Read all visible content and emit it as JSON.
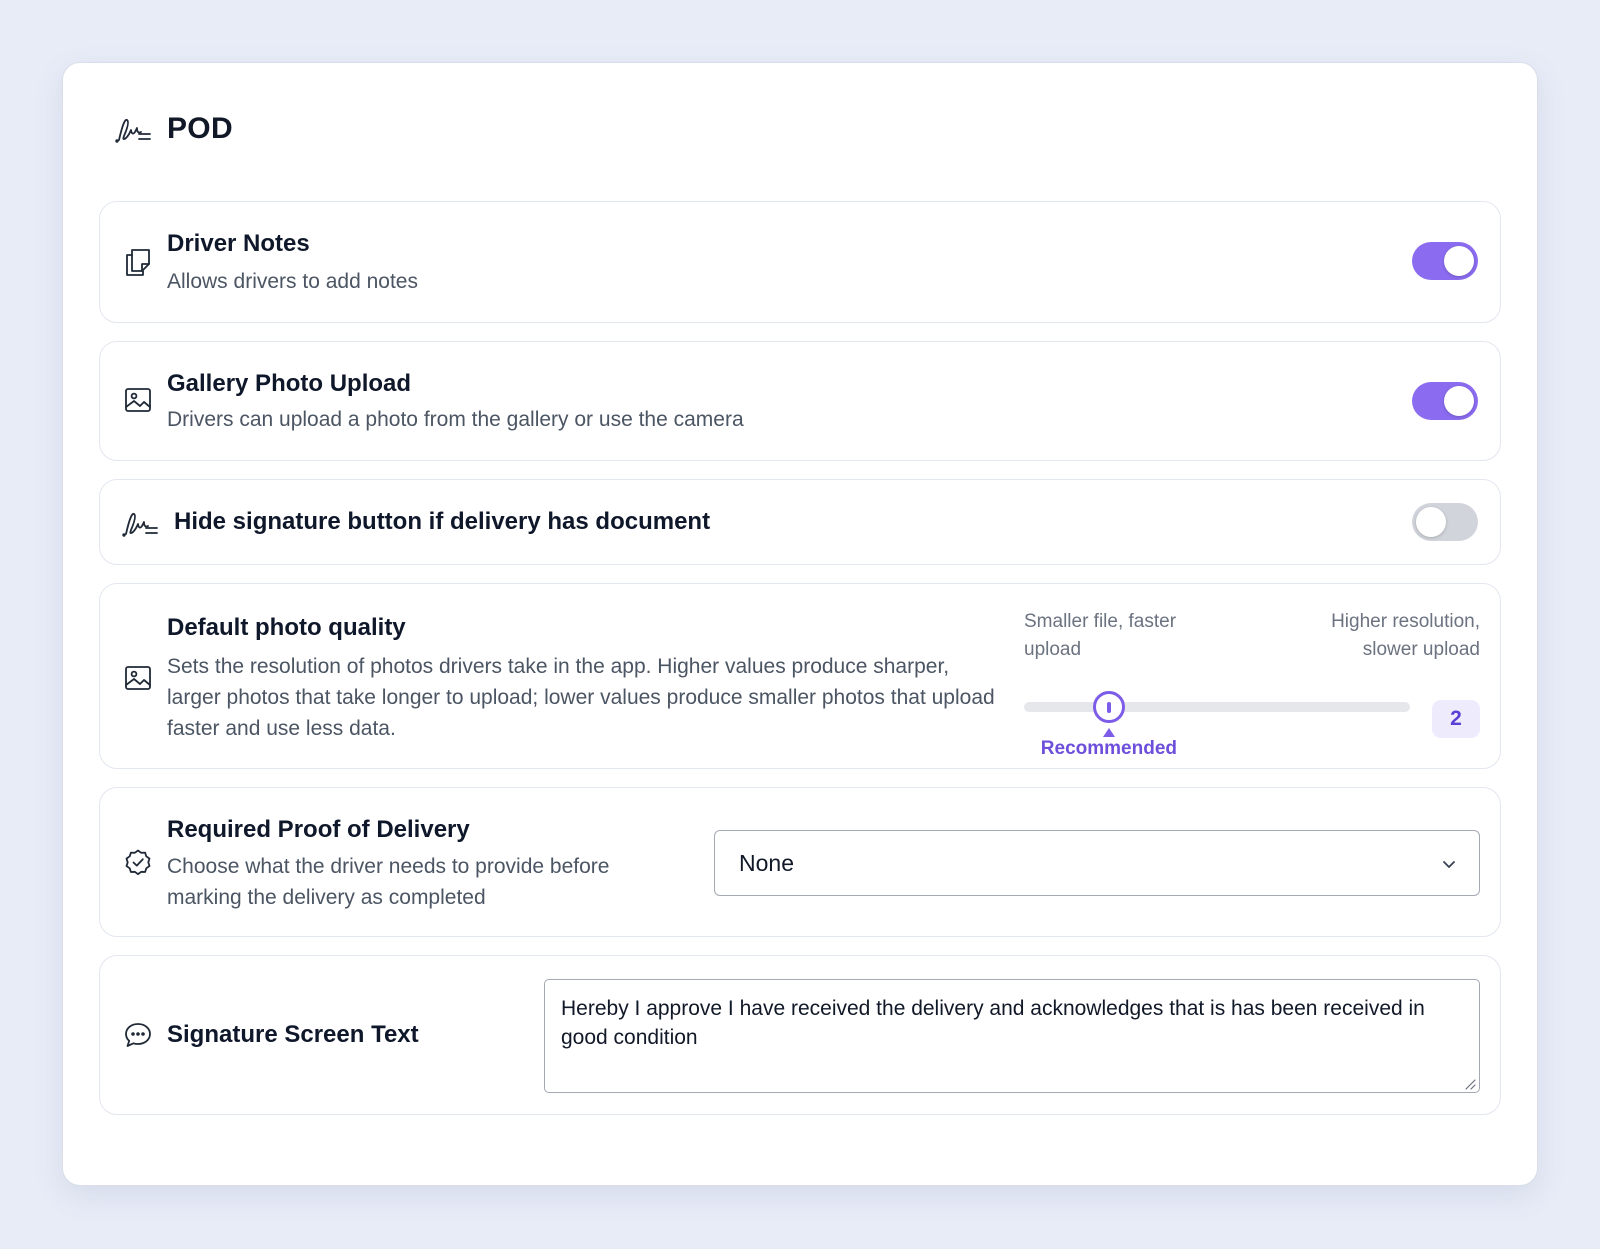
{
  "panel": {
    "title": "POD",
    "icon": "signature-icon"
  },
  "settings": {
    "driver_notes": {
      "title": "Driver Notes",
      "description": "Allows drivers to add notes",
      "icon": "notes-icon",
      "enabled": true
    },
    "gallery_upload": {
      "title": "Gallery Photo Upload",
      "description": "Drivers can upload a photo from the gallery or use the camera",
      "icon": "image-icon",
      "enabled": true
    },
    "hide_signature": {
      "title": "Hide signature button if delivery has document",
      "icon": "signature-icon",
      "enabled": false
    },
    "photo_quality": {
      "title": "Default photo quality",
      "description": "Sets the resolution of photos drivers take in the app. Higher values produce sharper, larger photos that take longer to upload; lower values produce smaller photos that upload faster and use less data.",
      "icon": "image-icon",
      "label_low": "Smaller file, faster upload",
      "label_high": "Higher resolution, slower upload",
      "recommended_label": "Recommended",
      "value": "2",
      "value_fraction": 0.22
    },
    "required_pod": {
      "title": "Required Proof of Delivery",
      "description": "Choose what the driver needs to provide before marking the delivery as completed",
      "icon": "badge-check-icon",
      "selected": "None"
    },
    "signature_text": {
      "title": "Signature Screen Text",
      "icon": "chat-bubble-icon",
      "value": "Hereby I approve I have received the delivery and acknowledges that is has been received in good condition"
    }
  },
  "colors": {
    "accent": "#8b6cf0",
    "accent_dark": "#6d4fdc",
    "toggle_off": "#d1d5db",
    "background": "#e8ecf7"
  }
}
